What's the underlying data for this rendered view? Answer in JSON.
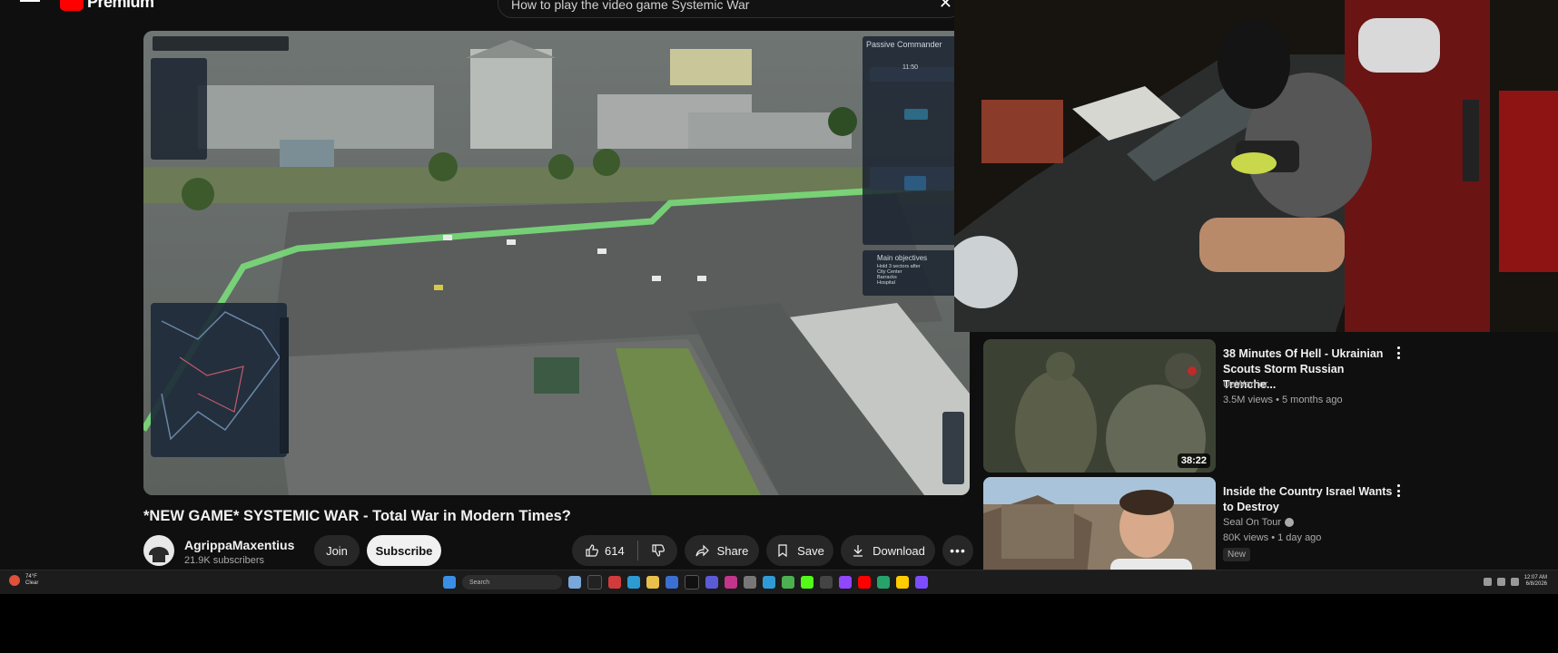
{
  "header": {
    "logo_text": "Premium",
    "search_query": "How to play the video game Systemic War"
  },
  "video": {
    "title": "*NEW GAME* SYSTEMIC WAR - Total War in Modern Times?",
    "channel": "AgrippaMaxentius",
    "subscribers": "21.9K subscribers",
    "join_label": "Join",
    "subscribe_label": "Subscribe",
    "likes": "614",
    "share_label": "Share",
    "save_label": "Save",
    "download_label": "Download",
    "hud": {
      "panel_title": "Passive Commander",
      "timer": "11:50",
      "objectives_title": "Main objectives",
      "objectives": [
        "Hold 3 sectors after",
        "City Center",
        "Barracks",
        "Hospital"
      ]
    }
  },
  "recommendations": [
    {
      "title": "38 Minutes Of Hell - Ukrainian Scouts Storm Russian Trenche...",
      "channel": "UaWarrior",
      "meta": "3.5M views • 5 months ago",
      "duration": "38:22"
    },
    {
      "title": "Inside the Country Israel Wants to Destroy",
      "channel": "Seal On Tour",
      "meta": "80K views • 1 day ago",
      "badge": "New"
    }
  ],
  "taskbar": {
    "weather_temp": "74°F",
    "weather_cond": "Clear",
    "search_label": "Search",
    "time": "12:07 AM",
    "date": "6/8/2026"
  },
  "colors": {
    "background": "#0f0f0f",
    "brand_red": "#ff0000",
    "button_bg": "#272727",
    "subscribe_bg": "#f1f1f1",
    "route_green": "#7be37b"
  }
}
